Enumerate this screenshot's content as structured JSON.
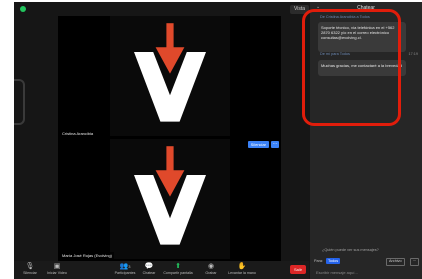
{
  "topbar": {
    "view_label": "Vista"
  },
  "videos": [
    {
      "participant_name": "Cristina Arancibia"
    },
    {
      "participant_name": "María José Rojas (Evolving)",
      "mute_label": "Silenciar",
      "more_label": "···"
    }
  ],
  "toolbar": {
    "items": [
      {
        "label": "Silenciar",
        "icon": "microphone-icon"
      },
      {
        "label": "Iniciar Video",
        "icon": "video-icon"
      },
      {
        "label": "Participantes",
        "icon": "participants-icon",
        "count": "3"
      },
      {
        "label": "Chatear",
        "icon": "chat-icon"
      },
      {
        "label": "Compartir pantalla",
        "icon": "share-screen-icon"
      },
      {
        "label": "Grabar",
        "icon": "record-icon"
      },
      {
        "label": "Levantar la mano",
        "icon": "raise-hand-icon"
      }
    ],
    "leave_label": "Salir"
  },
  "chat": {
    "title": "Chatear",
    "messages": [
      {
        "sender": "De Cristina Arancibia a Todos",
        "text": "Soporte técnico, vía telefónica en el +562 2870 6322 y/o en el correo electrónico consultas@evolving.cl."
      },
      {
        "sender": "De mí para Todos",
        "time": "17:19",
        "text": "Muchas gracias, me contactaré a la brevedad"
      }
    ],
    "who_can_see": "¿Quién puede ver sus mensajes?",
    "to_label": "Para:",
    "to_value": "Todos",
    "file_label": "Archivo",
    "more_label": "···",
    "input_placeholder": "Escribir mensaje aquí..."
  },
  "colors": {
    "accent": "#3b82f6",
    "leave": "#dc2626",
    "highlight": "#e11d0b",
    "logo_white": "#ffffff",
    "logo_arrow": "#e0492b"
  }
}
